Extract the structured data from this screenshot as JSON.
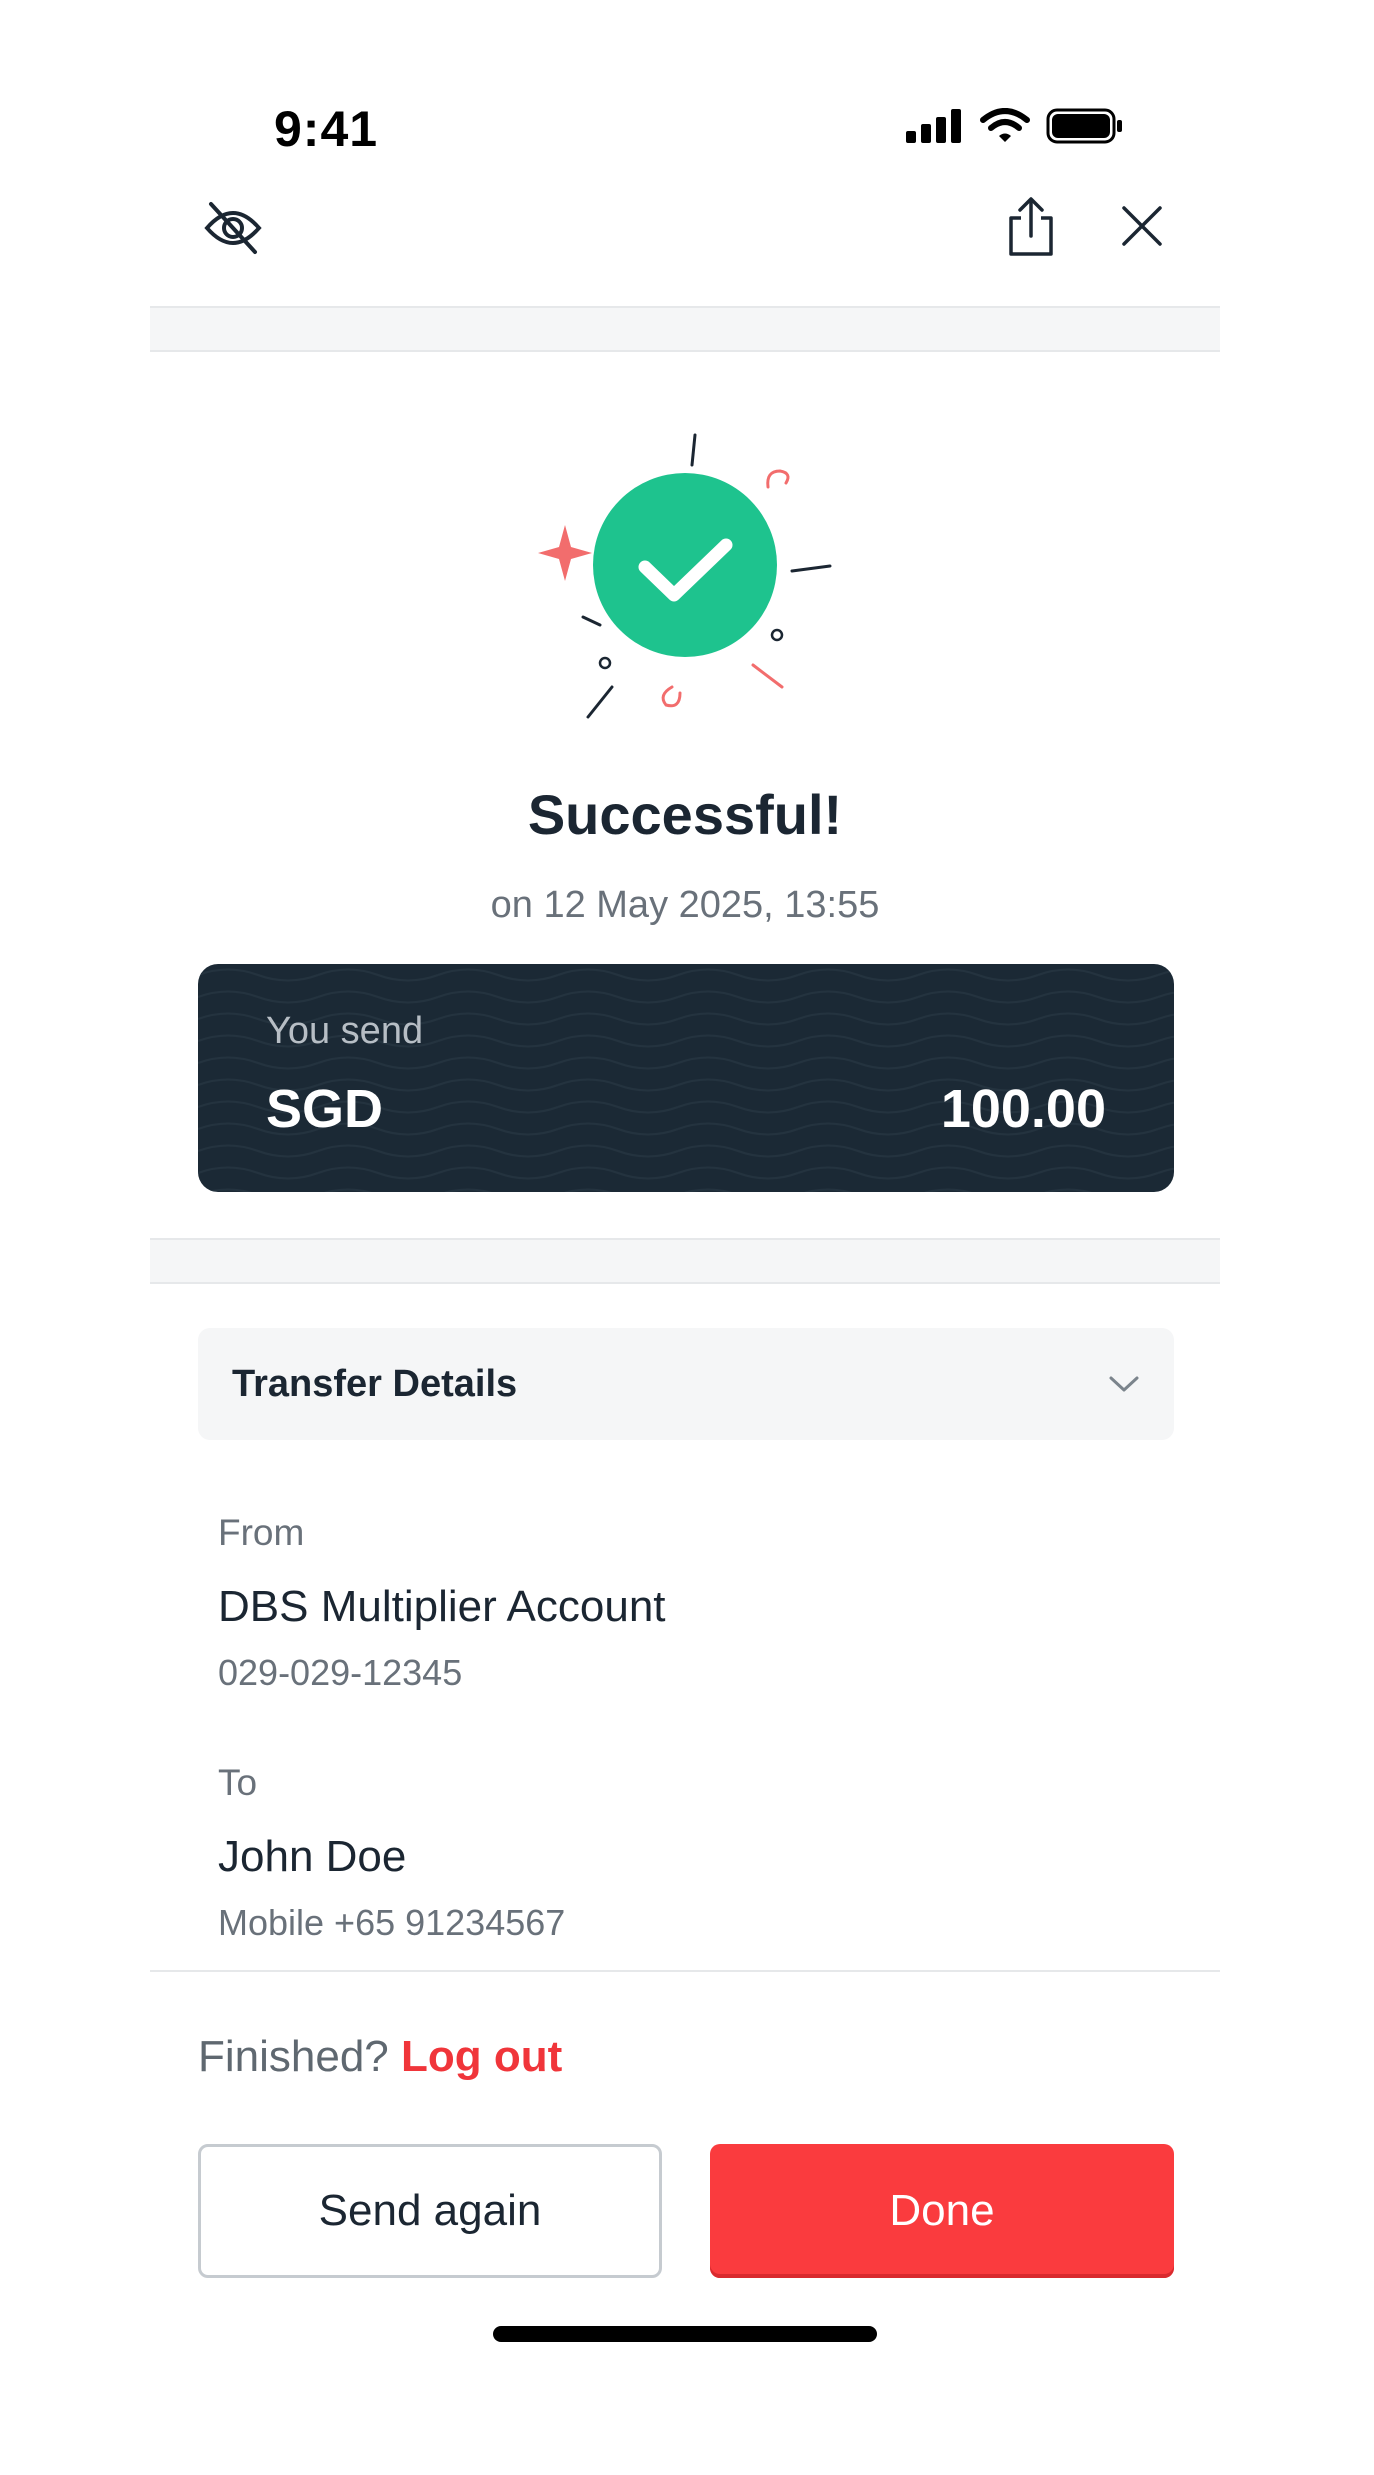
{
  "status_bar": {
    "time": "9:41"
  },
  "header": {
    "hide_icon": "eye-off-icon",
    "share_icon": "share-icon",
    "close_icon": "close-icon"
  },
  "result": {
    "title": "Successful!",
    "timestamp": "on 12 May 2025, 13:55",
    "icon": "check-circle-icon",
    "accent_color": "#1ec38e"
  },
  "amount_card": {
    "label": "You send",
    "currency": "SGD",
    "amount": "100.00",
    "background": "#1b2935"
  },
  "details": {
    "title": "Transfer Details",
    "expand_icon": "chevron-down-icon",
    "from": {
      "label": "From",
      "name": "DBS Multiplier Account",
      "account": "029-029-12345"
    },
    "to": {
      "label": "To",
      "name": "John Doe",
      "contact": "Mobile +65 91234567"
    }
  },
  "footer": {
    "finished_text": "Finished?",
    "logout_label": "Log out",
    "send_again_label": "Send again",
    "done_label": "Done",
    "brand_color": "#fa3b3e"
  }
}
